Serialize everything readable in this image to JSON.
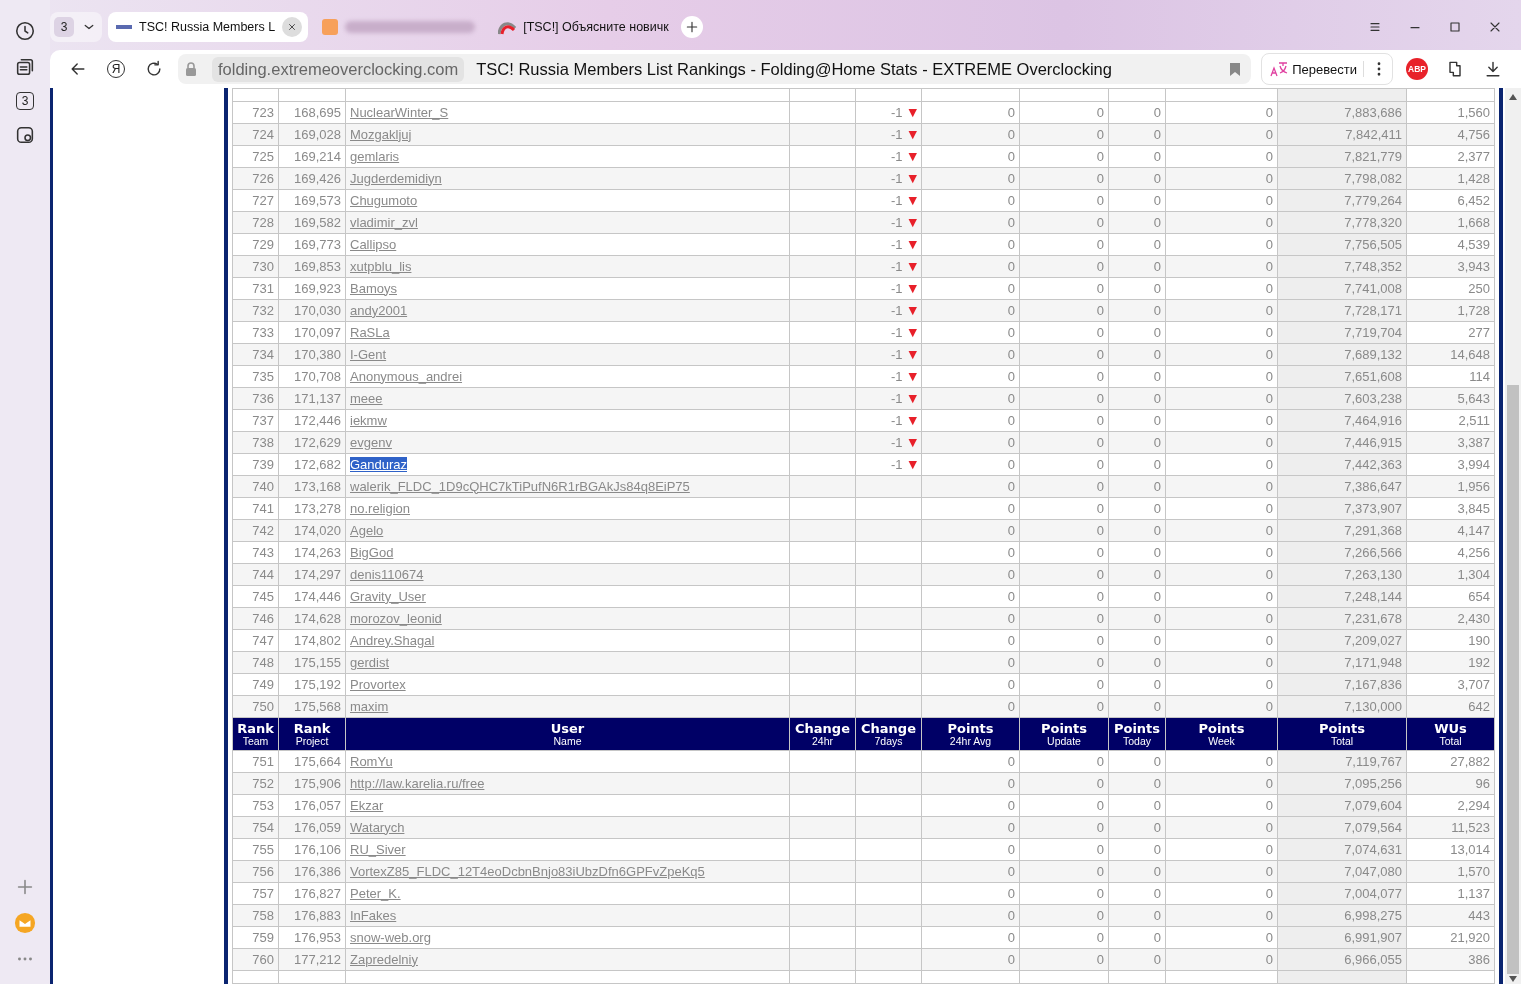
{
  "sidebar": {
    "tab_count": "3"
  },
  "tabs": {
    "count": "3",
    "items": [
      {
        "kind": "page",
        "title": "TSC! Russia Members L",
        "selected": true
      },
      {
        "kind": "blurred",
        "selected": false
      },
      {
        "kind": "page",
        "title": "[TSC!] Объясните новичк",
        "selected": false
      }
    ]
  },
  "toolbar": {
    "yandex": "Я",
    "url": "folding.extremeoverclocking.com",
    "page_title": "TSC! Russia Members List Rankings - Folding@Home Stats - EXTREME Overclocking",
    "translate": "Перевести",
    "adblock": "ABP"
  },
  "table": {
    "columns": [
      {
        "title": "Rank",
        "subtitle": "Team"
      },
      {
        "title": "Rank",
        "subtitle": "Project"
      },
      {
        "title": "User",
        "subtitle": "Name"
      },
      {
        "title": "Change",
        "subtitle": "24hr"
      },
      {
        "title": "Change",
        "subtitle": "7days"
      },
      {
        "title": "Points",
        "subtitle": "24hr Avg"
      },
      {
        "title": "Points",
        "subtitle": "Update"
      },
      {
        "title": "Points",
        "subtitle": "Today"
      },
      {
        "title": "Points",
        "subtitle": "Week"
      },
      {
        "title": "Points",
        "subtitle": "Total"
      },
      {
        "title": "WUs",
        "subtitle": "Total"
      }
    ],
    "rows_above": [
      {
        "rank_team": "723",
        "rank_project": "168,695",
        "user": "NuclearWinter_S",
        "change_7days": "-1",
        "arrow": "▼",
        "points_24hr_avg": "0",
        "points_update": "0",
        "points_today": "0",
        "points_week": "0",
        "points_total": "7,883,686",
        "wus_total": "1,560",
        "selected": false
      },
      {
        "rank_team": "724",
        "rank_project": "169,028",
        "user": "Mozgakljuj",
        "change_7days": "-1",
        "arrow": "▼",
        "points_24hr_avg": "0",
        "points_update": "0",
        "points_today": "0",
        "points_week": "0",
        "points_total": "7,842,411",
        "wus_total": "4,756",
        "selected": false
      },
      {
        "rank_team": "725",
        "rank_project": "169,214",
        "user": "gemlaris",
        "change_7days": "-1",
        "arrow": "▼",
        "points_24hr_avg": "0",
        "points_update": "0",
        "points_today": "0",
        "points_week": "0",
        "points_total": "7,821,779",
        "wus_total": "2,377",
        "selected": false
      },
      {
        "rank_team": "726",
        "rank_project": "169,426",
        "user": "Jugderdemidiyn",
        "change_7days": "-1",
        "arrow": "▼",
        "points_24hr_avg": "0",
        "points_update": "0",
        "points_today": "0",
        "points_week": "0",
        "points_total": "7,798,082",
        "wus_total": "1,428",
        "selected": false
      },
      {
        "rank_team": "727",
        "rank_project": "169,573",
        "user": "Chugumoto",
        "change_7days": "-1",
        "arrow": "▼",
        "points_24hr_avg": "0",
        "points_update": "0",
        "points_today": "0",
        "points_week": "0",
        "points_total": "7,779,264",
        "wus_total": "6,452",
        "selected": false
      },
      {
        "rank_team": "728",
        "rank_project": "169,582",
        "user": "vladimir_zvl",
        "change_7days": "-1",
        "arrow": "▼",
        "points_24hr_avg": "0",
        "points_update": "0",
        "points_today": "0",
        "points_week": "0",
        "points_total": "7,778,320",
        "wus_total": "1,668",
        "selected": false
      },
      {
        "rank_team": "729",
        "rank_project": "169,773",
        "user": "Callipso",
        "change_7days": "-1",
        "arrow": "▼",
        "points_24hr_avg": "0",
        "points_update": "0",
        "points_today": "0",
        "points_week": "0",
        "points_total": "7,756,505",
        "wus_total": "4,539",
        "selected": false
      },
      {
        "rank_team": "730",
        "rank_project": "169,853",
        "user": "xutpblu_lis",
        "change_7days": "-1",
        "arrow": "▼",
        "points_24hr_avg": "0",
        "points_update": "0",
        "points_today": "0",
        "points_week": "0",
        "points_total": "7,748,352",
        "wus_total": "3,943",
        "selected": false
      },
      {
        "rank_team": "731",
        "rank_project": "169,923",
        "user": "Bamoys",
        "change_7days": "-1",
        "arrow": "▼",
        "points_24hr_avg": "0",
        "points_update": "0",
        "points_today": "0",
        "points_week": "0",
        "points_total": "7,741,008",
        "wus_total": "250",
        "selected": false
      },
      {
        "rank_team": "732",
        "rank_project": "170,030",
        "user": "andy2001",
        "change_7days": "-1",
        "arrow": "▼",
        "points_24hr_avg": "0",
        "points_update": "0",
        "points_today": "0",
        "points_week": "0",
        "points_total": "7,728,171",
        "wus_total": "1,728",
        "selected": false
      },
      {
        "rank_team": "733",
        "rank_project": "170,097",
        "user": "RaSLa",
        "change_7days": "-1",
        "arrow": "▼",
        "points_24hr_avg": "0",
        "points_update": "0",
        "points_today": "0",
        "points_week": "0",
        "points_total": "7,719,704",
        "wus_total": "277",
        "selected": false
      },
      {
        "rank_team": "734",
        "rank_project": "170,380",
        "user": "I-Gent",
        "change_7days": "-1",
        "arrow": "▼",
        "points_24hr_avg": "0",
        "points_update": "0",
        "points_today": "0",
        "points_week": "0",
        "points_total": "7,689,132",
        "wus_total": "14,648",
        "selected": false
      },
      {
        "rank_team": "735",
        "rank_project": "170,708",
        "user": "Anonymous_andrei",
        "change_7days": "-1",
        "arrow": "▼",
        "points_24hr_avg": "0",
        "points_update": "0",
        "points_today": "0",
        "points_week": "0",
        "points_total": "7,651,608",
        "wus_total": "114",
        "selected": false
      },
      {
        "rank_team": "736",
        "rank_project": "171,137",
        "user": "meee",
        "change_7days": "-1",
        "arrow": "▼",
        "points_24hr_avg": "0",
        "points_update": "0",
        "points_today": "0",
        "points_week": "0",
        "points_total": "7,603,238",
        "wus_total": "5,643",
        "selected": false
      },
      {
        "rank_team": "737",
        "rank_project": "172,446",
        "user": "iekmw",
        "change_7days": "-1",
        "arrow": "▼",
        "points_24hr_avg": "0",
        "points_update": "0",
        "points_today": "0",
        "points_week": "0",
        "points_total": "7,464,916",
        "wus_total": "2,511",
        "selected": false
      },
      {
        "rank_team": "738",
        "rank_project": "172,629",
        "user": "evgenv",
        "change_7days": "-1",
        "arrow": "▼",
        "points_24hr_avg": "0",
        "points_update": "0",
        "points_today": "0",
        "points_week": "0",
        "points_total": "7,446,915",
        "wus_total": "3,387",
        "selected": false
      },
      {
        "rank_team": "739",
        "rank_project": "172,682",
        "user": "Ganduraz",
        "change_7days": "-1",
        "arrow": "▼",
        "points_24hr_avg": "0",
        "points_update": "0",
        "points_today": "0",
        "points_week": "0",
        "points_total": "7,442,363",
        "wus_total": "3,994",
        "selected": true
      },
      {
        "rank_team": "740",
        "rank_project": "173,168",
        "user": "walerik_FLDC_1D9cQHC7kTiPufN6R1rBGAkJs84q8EiP75",
        "points_24hr_avg": "0",
        "points_update": "0",
        "points_today": "0",
        "points_week": "0",
        "points_total": "7,386,647",
        "wus_total": "1,956",
        "selected": false
      },
      {
        "rank_team": "741",
        "rank_project": "173,278",
        "user": "no.religion",
        "points_24hr_avg": "0",
        "points_update": "0",
        "points_today": "0",
        "points_week": "0",
        "points_total": "7,373,907",
        "wus_total": "3,845",
        "selected": false
      },
      {
        "rank_team": "742",
        "rank_project": "174,020",
        "user": "Agelo",
        "points_24hr_avg": "0",
        "points_update": "0",
        "points_today": "0",
        "points_week": "0",
        "points_total": "7,291,368",
        "wus_total": "4,147",
        "selected": false
      },
      {
        "rank_team": "743",
        "rank_project": "174,263",
        "user": "BigGod",
        "points_24hr_avg": "0",
        "points_update": "0",
        "points_today": "0",
        "points_week": "0",
        "points_total": "7,266,566",
        "wus_total": "4,256",
        "selected": false
      },
      {
        "rank_team": "744",
        "rank_project": "174,297",
        "user": "denis110674",
        "points_24hr_avg": "0",
        "points_update": "0",
        "points_today": "0",
        "points_week": "0",
        "points_total": "7,263,130",
        "wus_total": "1,304",
        "selected": false
      },
      {
        "rank_team": "745",
        "rank_project": "174,446",
        "user": "Gravity_User",
        "points_24hr_avg": "0",
        "points_update": "0",
        "points_today": "0",
        "points_week": "0",
        "points_total": "7,248,144",
        "wus_total": "654",
        "selected": false
      },
      {
        "rank_team": "746",
        "rank_project": "174,628",
        "user": "morozov_leonid",
        "points_24hr_avg": "0",
        "points_update": "0",
        "points_today": "0",
        "points_week": "0",
        "points_total": "7,231,678",
        "wus_total": "2,430",
        "selected": false
      },
      {
        "rank_team": "747",
        "rank_project": "174,802",
        "user": "Andrey.Shagal",
        "points_24hr_avg": "0",
        "points_update": "0",
        "points_today": "0",
        "points_week": "0",
        "points_total": "7,209,027",
        "wus_total": "190",
        "selected": false
      },
      {
        "rank_team": "748",
        "rank_project": "175,155",
        "user": "gerdist",
        "points_24hr_avg": "0",
        "points_update": "0",
        "points_today": "0",
        "points_week": "0",
        "points_total": "7,171,948",
        "wus_total": "192",
        "selected": false
      },
      {
        "rank_team": "749",
        "rank_project": "175,192",
        "user": "Provortex",
        "points_24hr_avg": "0",
        "points_update": "0",
        "points_today": "0",
        "points_week": "0",
        "points_total": "7,167,836",
        "wus_total": "3,707",
        "selected": false
      },
      {
        "rank_team": "750",
        "rank_project": "175,568",
        "user": "maxim",
        "points_24hr_avg": "0",
        "points_update": "0",
        "points_today": "0",
        "points_week": "0",
        "points_total": "7,130,000",
        "wus_total": "642",
        "selected": false
      }
    ],
    "rows_below": [
      {
        "rank_team": "751",
        "rank_project": "175,664",
        "user": "RomYu",
        "points_24hr_avg": "0",
        "points_update": "0",
        "points_today": "0",
        "points_week": "0",
        "points_total": "7,119,767",
        "wus_total": "27,882",
        "selected": false
      },
      {
        "rank_team": "752",
        "rank_project": "175,906",
        "user": "http://law.karelia.ru/free",
        "points_24hr_avg": "0",
        "points_update": "0",
        "points_today": "0",
        "points_week": "0",
        "points_total": "7,095,256",
        "wus_total": "96",
        "selected": false
      },
      {
        "rank_team": "753",
        "rank_project": "176,057",
        "user": "Ekzar",
        "points_24hr_avg": "0",
        "points_update": "0",
        "points_today": "0",
        "points_week": "0",
        "points_total": "7,079,604",
        "wus_total": "2,294",
        "selected": false
      },
      {
        "rank_team": "754",
        "rank_project": "176,059",
        "user": "Watarych",
        "points_24hr_avg": "0",
        "points_update": "0",
        "points_today": "0",
        "points_week": "0",
        "points_total": "7,079,564",
        "wus_total": "11,523",
        "selected": false
      },
      {
        "rank_team": "755",
        "rank_project": "176,106",
        "user": "RU_Siver",
        "points_24hr_avg": "0",
        "points_update": "0",
        "points_today": "0",
        "points_week": "0",
        "points_total": "7,074,631",
        "wus_total": "13,014",
        "selected": false
      },
      {
        "rank_team": "756",
        "rank_project": "176,386",
        "user": "VortexZ85_FLDC_12T4eoDcbnBnjo83iUbzDfn6GPFvZpeKq5",
        "points_24hr_avg": "0",
        "points_update": "0",
        "points_today": "0",
        "points_week": "0",
        "points_total": "7,047,080",
        "wus_total": "1,570",
        "selected": false
      },
      {
        "rank_team": "757",
        "rank_project": "176,827",
        "user": "Peter_K.",
        "points_24hr_avg": "0",
        "points_update": "0",
        "points_today": "0",
        "points_week": "0",
        "points_total": "7,004,077",
        "wus_total": "1,137",
        "selected": false
      },
      {
        "rank_team": "758",
        "rank_project": "176,883",
        "user": "InFakes",
        "points_24hr_avg": "0",
        "points_update": "0",
        "points_today": "0",
        "points_week": "0",
        "points_total": "6,998,275",
        "wus_total": "443",
        "selected": false
      },
      {
        "rank_team": "759",
        "rank_project": "176,953",
        "user": "snow-web.org",
        "points_24hr_avg": "0",
        "points_update": "0",
        "points_today": "0",
        "points_week": "0",
        "points_total": "6,991,907",
        "wus_total": "21,920",
        "selected": false
      },
      {
        "rank_team": "760",
        "rank_project": "177,212",
        "user": "Zapredelniy",
        "points_24hr_avg": "0",
        "points_update": "0",
        "points_today": "0",
        "points_week": "0",
        "points_total": "6,966,055",
        "wus_total": "386",
        "selected": false
      }
    ]
  }
}
